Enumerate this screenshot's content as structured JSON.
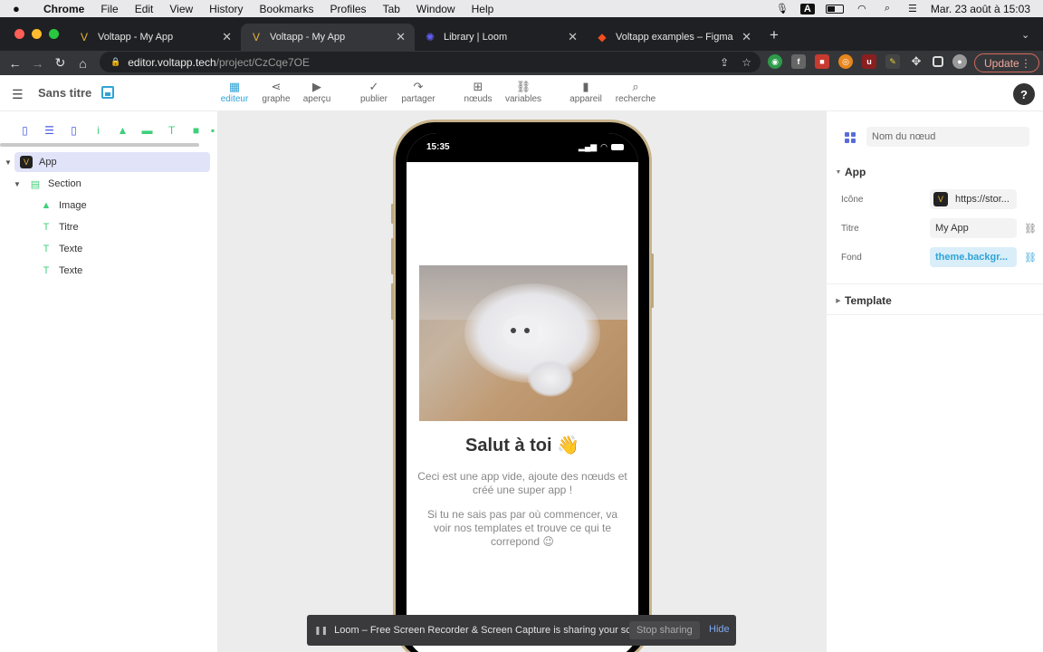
{
  "menubar": {
    "app": "Chrome",
    "items": [
      "File",
      "Edit",
      "View",
      "History",
      "Bookmarks",
      "Profiles",
      "Tab",
      "Window",
      "Help"
    ],
    "datetime": "Mar. 23 août à 15:03",
    "input_source": "A"
  },
  "tabs": [
    {
      "title": "Voltapp - My App",
      "icon": "voltapp-icon",
      "active": false
    },
    {
      "title": "Voltapp - My App",
      "icon": "voltapp-icon",
      "active": true
    },
    {
      "title": "Library | Loom",
      "icon": "loom-icon",
      "active": false
    },
    {
      "title": "Voltapp examples – Figma",
      "icon": "figma-icon",
      "active": false
    }
  ],
  "address": {
    "domain": "editor.voltapp.tech",
    "path": "/project/CzCqe7OE"
  },
  "browser": {
    "update_label": "Update"
  },
  "toolbar": {
    "doc_title": "Sans titre",
    "tools": [
      {
        "label": "editeur",
        "icon": "grid-icon",
        "active": true
      },
      {
        "label": "graphe",
        "icon": "share-graph-icon",
        "active": false
      },
      {
        "label": "aperçu",
        "icon": "play-icon",
        "active": false
      },
      {
        "label": "publier",
        "icon": "check-icon",
        "active": false
      },
      {
        "label": "partager",
        "icon": "share-arrow-icon",
        "active": false
      },
      {
        "label": "nœuds",
        "icon": "plus-square-icon",
        "active": false
      },
      {
        "label": "variables",
        "icon": "link-icon",
        "active": false
      },
      {
        "label": "appareil",
        "icon": "device-icon",
        "active": false
      },
      {
        "label": "recherche",
        "icon": "search-icon",
        "active": false
      }
    ],
    "help_label": "?"
  },
  "layers": [
    {
      "label": "App",
      "icon": "app-icon",
      "level": 0,
      "expanded": true,
      "selected": true
    },
    {
      "label": "Section",
      "icon": "section-icon",
      "level": 1,
      "expanded": true,
      "selected": false
    },
    {
      "label": "Image",
      "icon": "image-icon",
      "level": 2,
      "selected": false
    },
    {
      "label": "Titre",
      "icon": "text-icon",
      "level": 2,
      "selected": false
    },
    {
      "label": "Texte",
      "icon": "text-icon",
      "level": 2,
      "selected": false
    },
    {
      "label": "Texte",
      "icon": "text-icon",
      "level": 2,
      "selected": false
    }
  ],
  "phone": {
    "time": "15:35",
    "title": "Salut à toi 👋",
    "text1": "Ceci est une app vide, ajoute des nœuds et créé une super app !",
    "text2": "Si tu ne sais pas par où commencer, va voir nos templates et trouve ce qui te correpond 😉"
  },
  "inspector": {
    "node_name_placeholder": "Nom du nœud",
    "section_app": "App",
    "props": {
      "icon_label": "Icône",
      "icon_value": "https://stor...",
      "title_label": "Titre",
      "title_value": "My App",
      "bg_label": "Fond",
      "bg_value": "theme.backgr..."
    },
    "section_template": "Template"
  },
  "loom": {
    "message": "Loom – Free Screen Recorder & Screen Capture is sharing your screen.",
    "stop_label": "Stop sharing",
    "hide_label": "Hide"
  },
  "colors": {
    "accent": "#2fa3d6",
    "selection": "#e1e3f9",
    "node_green": "#3fcf7a"
  }
}
